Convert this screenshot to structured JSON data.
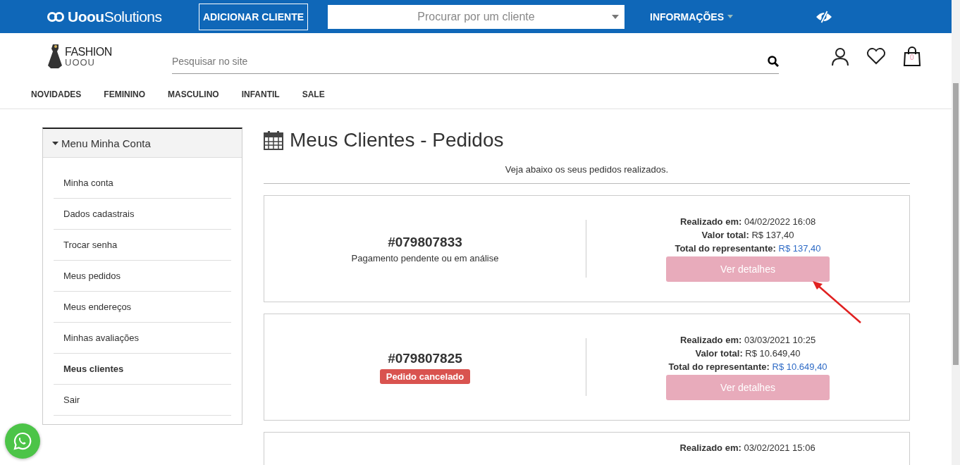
{
  "topbar": {
    "brand": {
      "bold": "Uoou",
      "light": "Solutions"
    },
    "add_button": "ADICIONAR CLIENTE",
    "client_select": {
      "placeholder": "Procurar por um cliente"
    },
    "info_menu": "INFORMAÇÕES"
  },
  "store_header": {
    "logo": {
      "top": "FASHION",
      "bottom": "UOOU"
    },
    "search": {
      "placeholder": "Pesquisar no site"
    },
    "cart_count": "0"
  },
  "nav": [
    "NOVIDADES",
    "FEMININO",
    "MASCULINO",
    "INFANTIL",
    "SALE"
  ],
  "sidebar": {
    "title": "Menu Minha Conta",
    "items": [
      {
        "label": "Minha conta",
        "selected": false
      },
      {
        "label": "Dados cadastrais",
        "selected": false
      },
      {
        "label": "Trocar senha",
        "selected": false
      },
      {
        "label": "Meus pedidos",
        "selected": false
      },
      {
        "label": "Meus endereços",
        "selected": false
      },
      {
        "label": "Minhas avaliações",
        "selected": false
      },
      {
        "label": "Meus clientes",
        "selected": true
      },
      {
        "label": "Sair",
        "selected": false
      }
    ]
  },
  "page": {
    "title": "Meus Clientes - Pedidos",
    "subtitle": "Veja abaixo os seus pedidos realizados."
  },
  "orders": [
    {
      "number": "#079807833",
      "status": {
        "kind": "text",
        "label": "Pagamento pendente ou em análise"
      },
      "date_label": "Realizado em:",
      "date": "04/02/2022 16:08",
      "total_label": "Valor total:",
      "total": "R$ 137,40",
      "rep_label": "Total do representante:",
      "rep_total": "R$ 137,40",
      "button": "Ver detalhes",
      "annotated": true
    },
    {
      "number": "#079807825",
      "status": {
        "kind": "badge",
        "label": "Pedido cancelado"
      },
      "date_label": "Realizado em:",
      "date": "03/03/2021 10:25",
      "total_label": "Valor total:",
      "total": "R$ 10.649,40",
      "rep_label": "Total do representante:",
      "rep_total": "R$ 10.649,40",
      "button": "Ver detalhes",
      "annotated": false
    }
  ],
  "partial_order": {
    "date_label": "Realizado em:",
    "date": "03/02/2021 15:06"
  }
}
